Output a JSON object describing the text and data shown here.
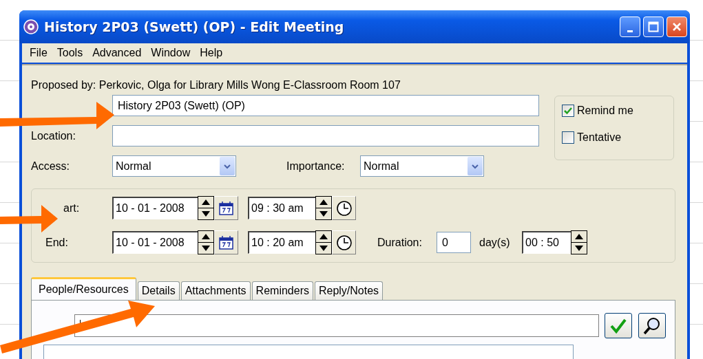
{
  "window": {
    "title": "History 2P03 (Swett) (OP) - Edit Meeting"
  },
  "menu": [
    "File",
    "Tools",
    "Advanced",
    "Window",
    "Help"
  ],
  "proposed_by": "Proposed by: Perkovic, Olga for Library Mills Wong E-Classroom Room 107",
  "title_field": {
    "value": "History 2P03 (Swett) (OP)"
  },
  "location": {
    "label": "Location:"
  },
  "access": {
    "label": "Access:",
    "value": "Normal"
  },
  "importance": {
    "label": "Importance:",
    "value": "Normal"
  },
  "options": [
    {
      "label": "Remind me",
      "checked": true
    },
    {
      "label": "Tentative",
      "checked": false
    }
  ],
  "start": {
    "label": "art:",
    "date": "10 - 01 - 2008",
    "time": "09 : 30 am"
  },
  "end": {
    "label": "End:",
    "date": "10 - 01 - 2008",
    "time": "10 : 20 am"
  },
  "duration": {
    "label": "Duration:",
    "days": "0",
    "unit": "day(s)",
    "time": "00 : 50"
  },
  "tabs": [
    {
      "label": "People/Resources",
      "selected": true
    },
    {
      "label": "Details",
      "selected": false
    },
    {
      "label": "Attachments",
      "selected": false
    },
    {
      "label": "Reminders",
      "selected": false
    },
    {
      "label": "Reply/Notes",
      "selected": false
    }
  ]
}
